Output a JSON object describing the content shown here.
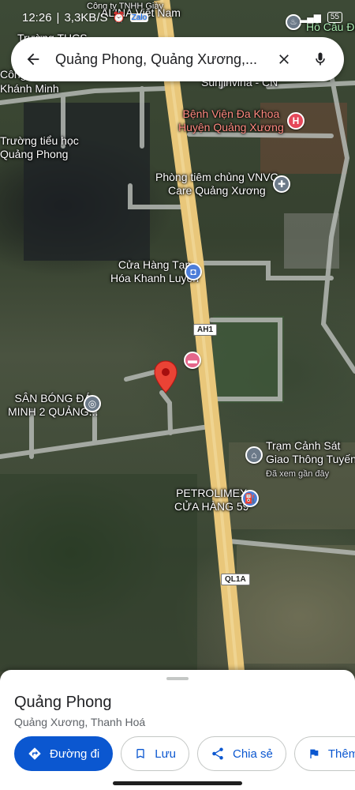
{
  "status_bar": {
    "time": "12:26",
    "speed": "3,3KB/S",
    "battery": "55"
  },
  "search": {
    "query": "Quảng Phong, Quảng Xương,..."
  },
  "map": {
    "labels": {
      "top_road": "Công ty TNHH Giày",
      "alina": "ALINA Việt Nam",
      "truong_thcs": "Trường THCS",
      "cong_ty": "Công ty",
      "khanh_minh": "Khánh Minh",
      "sunjinvina": "Sunjinvina - CN",
      "ho_cau_dat": "Hồ Câu Đạt",
      "benh_vien": "Bệnh Viện Đa Khoa\nHuyện Quảng Xương",
      "truong_tieu_hoc": "Trường tiểu học\nQuảng Phong",
      "phong_tiem": "Phòng tiêm chủng VNVC\nCare Quảng Xương",
      "cua_hang": "Cửa Hàng Tạp\nHóa Khanh Luyến",
      "san_bong": "SÂN BÓNG ĐÁ\nMINH 2 QUẢNG...",
      "tram_canh_sat": "Trạm Cảnh Sát\nGiao Thông Tuyến",
      "da_xem": "Đã xem gần đây",
      "petrolimex": "PETROLIMEX\nCỬA HÀNG 59"
    },
    "route_badges": {
      "ah1": "AH1",
      "ql1a": "QL1A"
    },
    "colors": {
      "highway": "#e9c77a",
      "road": "#b5b9b4",
      "pin": "#ea4335"
    }
  },
  "sheet": {
    "place_name": "Quảng Phong",
    "place_sub": "Quảng Xương, Thanh Hoá",
    "actions": {
      "directions": "Đường đi",
      "save": "Lưu",
      "share": "Chia sẻ",
      "more": "Thêm"
    }
  }
}
